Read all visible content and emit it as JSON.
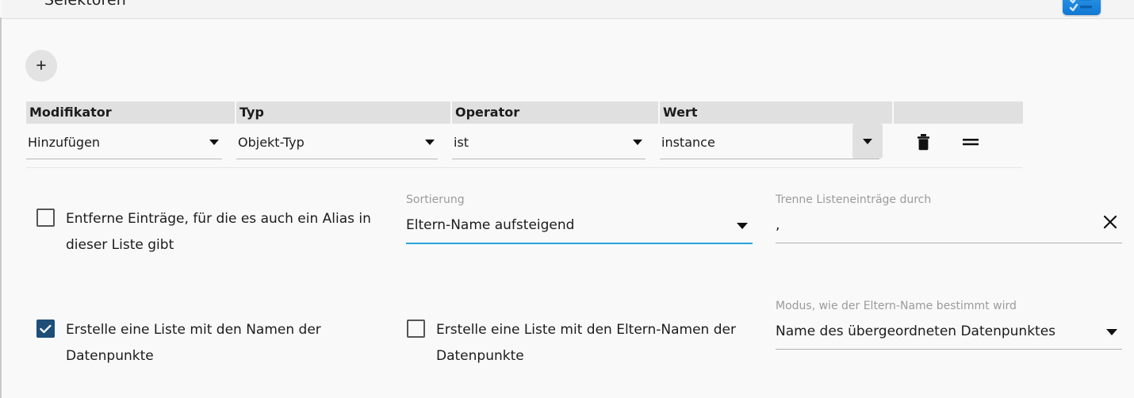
{
  "header": {
    "title": "Selektoren",
    "action_icon": "checklist-icon"
  },
  "toolbar": {
    "add_label": "+"
  },
  "selector_table": {
    "columns": [
      "Modifikator",
      "Typ",
      "Operator",
      "Wert",
      ""
    ],
    "rows": [
      {
        "modifikator": "Hinzufügen",
        "typ": "Objekt-Typ",
        "operator": "ist",
        "wert": "instance",
        "delete_icon": "trash-icon",
        "drag_icon": "drag-handle-icon"
      }
    ]
  },
  "options": {
    "remove_alias_checkbox": {
      "label": "Entferne Einträge, für die es auch ein Alias in dieser Liste gibt",
      "checked": false
    },
    "sorting": {
      "label": "Sortierung",
      "value": "Eltern-Name aufsteigend"
    },
    "separator": {
      "label": "Trenne Listeneinträge durch",
      "value": ",",
      "clear_icon": "close-icon"
    },
    "names_list_checkbox": {
      "label": "Erstelle eine Liste mit den Namen der Datenpunkte",
      "checked": true
    },
    "parent_names_list_checkbox": {
      "label": "Erstelle eine Liste mit den Eltern-Namen der Datenpunkte",
      "checked": false
    },
    "parent_name_mode": {
      "label": "Modus, wie der Eltern-Name bestimmt wird",
      "value": "Name des übergeordneten Datenpunktes"
    }
  },
  "colors": {
    "accent_blue": "#1178d4",
    "checkbox_checked": "#1f4e79",
    "focus_underline": "#29a3dc"
  }
}
